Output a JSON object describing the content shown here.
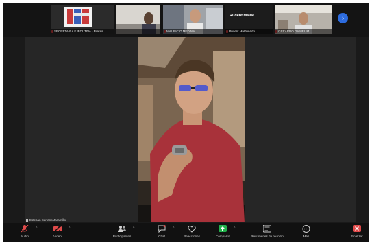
{
  "participants": [
    {
      "name": "SECRETARIA EJECUTIVA - Pilares...",
      "muted": true,
      "kind": "logo"
    },
    {
      "name": "",
      "muted": false,
      "kind": "person"
    },
    {
      "name": "MAURICIO MEDINA...",
      "muted": true,
      "kind": "person"
    },
    {
      "name": "Rudent Maldonado",
      "display_title": "Rudent Malde...",
      "muted": true,
      "kind": "title"
    },
    {
      "name": "GERARDO DANIEL M...",
      "muted": true,
      "kind": "person"
    }
  ],
  "next_page_label": "›",
  "speaker": {
    "name": "Esteban Serrano Jaramillo"
  },
  "toolbar": [
    {
      "label": "Audio",
      "icon": "mic-muted-icon",
      "color": "#e04a4a"
    },
    {
      "label": "Video",
      "icon": "video-off-icon",
      "color": "#e04a4a"
    },
    {
      "label": "Participantes",
      "icon": "participants-icon",
      "badge": "22"
    },
    {
      "label": "Chat",
      "icon": "chat-icon",
      "badge": "1"
    },
    {
      "label": "Reacciones",
      "icon": "reactions-icon"
    },
    {
      "label": "Compartir",
      "icon": "share-screen-icon",
      "color": "#22b24c"
    },
    {
      "label": "Resúmenes de reunión",
      "icon": "meeting-summary-icon"
    },
    {
      "label": "Más",
      "icon": "more-icon"
    },
    {
      "label": "Finalizar",
      "icon": "end-meeting-icon",
      "color": "#e04a4a"
    }
  ]
}
